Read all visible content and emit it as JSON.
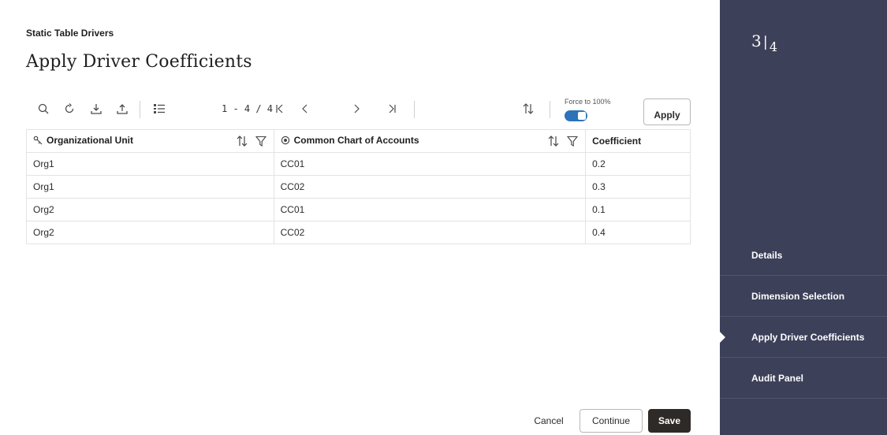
{
  "header": {
    "eyebrow": "Static Table Drivers",
    "title": "Apply Driver Coefficients"
  },
  "toolbar": {
    "icons": [
      "search-icon",
      "refresh-icon",
      "download-icon",
      "upload-icon",
      "list-icon",
      "first-page-icon",
      "prev-page-icon",
      "next-page-icon",
      "last-page-icon",
      "sort-icon"
    ],
    "range_label": "1 - 4 / 4",
    "force_label": "Force to 100%",
    "force_enabled": true,
    "apply_label": "Apply"
  },
  "table": {
    "columns": [
      {
        "label": "Organizational Unit",
        "icon": "key-icon"
      },
      {
        "label": "Common Chart of Accounts",
        "icon": "target-icon"
      },
      {
        "label": "Coefficient"
      }
    ],
    "rows": [
      [
        "Org1",
        "CC01",
        "0.2"
      ],
      [
        "Org1",
        "CC02",
        "0.3"
      ],
      [
        "Org2",
        "CC01",
        "0.1"
      ],
      [
        "Org2",
        "CC02",
        "0.4"
      ]
    ]
  },
  "footer": {
    "cancel_label": "Cancel",
    "continue_label": "Continue",
    "save_label": "Save"
  },
  "sidebar": {
    "step_current": "3",
    "step_total": "4",
    "items": [
      {
        "label": "Details"
      },
      {
        "label": "Dimension Selection"
      },
      {
        "label": "Apply Driver Coefficients",
        "active": true
      },
      {
        "label": "Audit Panel"
      }
    ]
  },
  "colors": {
    "sidebar_bg": "#3c4059",
    "toggle_on": "#2c73b9",
    "save_bg": "#2e2a28"
  }
}
